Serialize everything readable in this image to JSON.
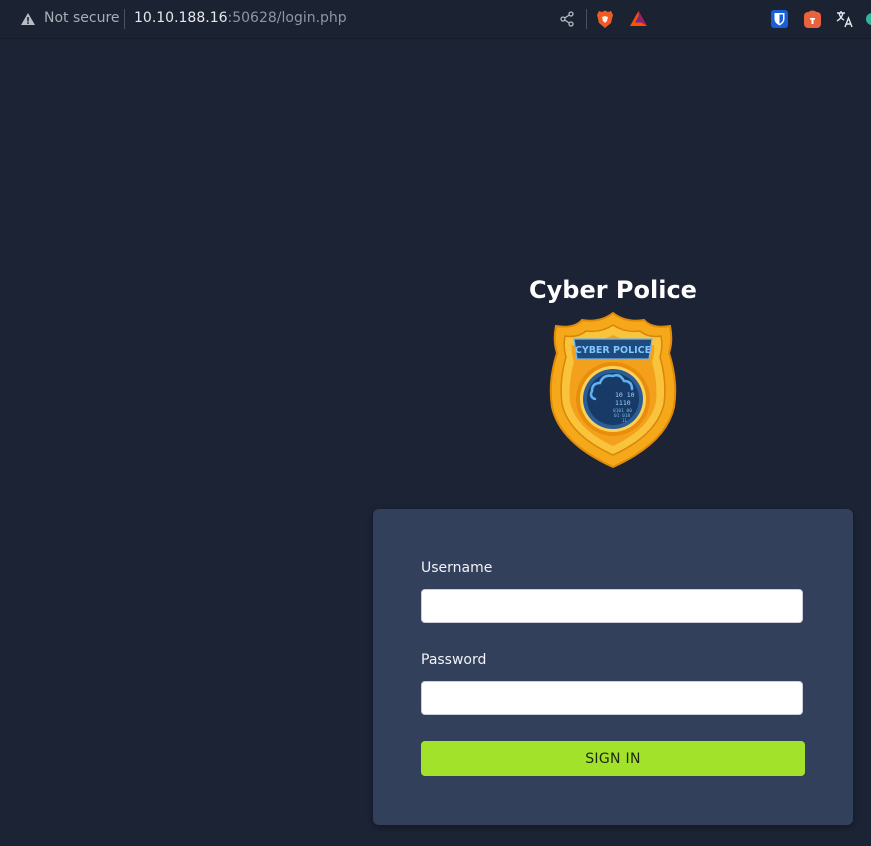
{
  "browser": {
    "security_label": "Not secure",
    "url_host": "10.10.188.16",
    "url_rest": ":50628/login.php"
  },
  "page": {
    "brand_title": "Cyber Police",
    "badge": {
      "banner_text": "CYBER POLICE",
      "digits": [
        "10 10",
        "1110",
        "0101 00",
        "01 010",
        "11"
      ]
    }
  },
  "form": {
    "username_label": "Username",
    "username_value": "",
    "password_label": "Password",
    "password_value": "",
    "submit_label": "SIGN IN"
  },
  "colors": {
    "background": "#1b2335",
    "card": "#33405c",
    "button": "#a2e22b",
    "badge_gold": "#f2a516"
  }
}
